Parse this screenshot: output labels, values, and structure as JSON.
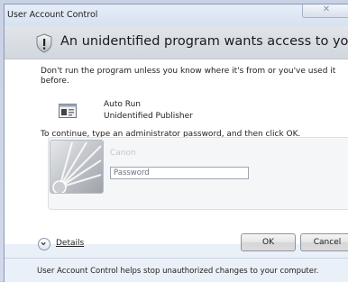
{
  "window": {
    "title": "User Account Control",
    "close_glyph": "✕"
  },
  "header": {
    "text": "An unidentified program wants access to your computer"
  },
  "warning": {
    "text": "Don't run the program unless you know where it's from or you've used it before."
  },
  "program": {
    "name": "Auto Run",
    "publisher": "Unidentified Publisher"
  },
  "instruction": "To continue, type an administrator password, and then click OK.",
  "credential": {
    "username": "Canon",
    "password_placeholder": "Password",
    "password_value": ""
  },
  "details": {
    "label": "Details"
  },
  "buttons": {
    "ok": "OK",
    "cancel": "Cancel"
  },
  "footer": {
    "text": "User Account Control helps stop unauthorized changes to your computer."
  },
  "icons": {
    "shield": "uac-shield-icon",
    "program": "program-icon",
    "user": "user-picture",
    "details": "chevron-down-icon"
  },
  "colors": {
    "dialog_bg": "#eaf0f8",
    "header_band": "#d9dde3",
    "content_bg": "#ffffff",
    "desktop_bg": "#c9d1e4"
  }
}
